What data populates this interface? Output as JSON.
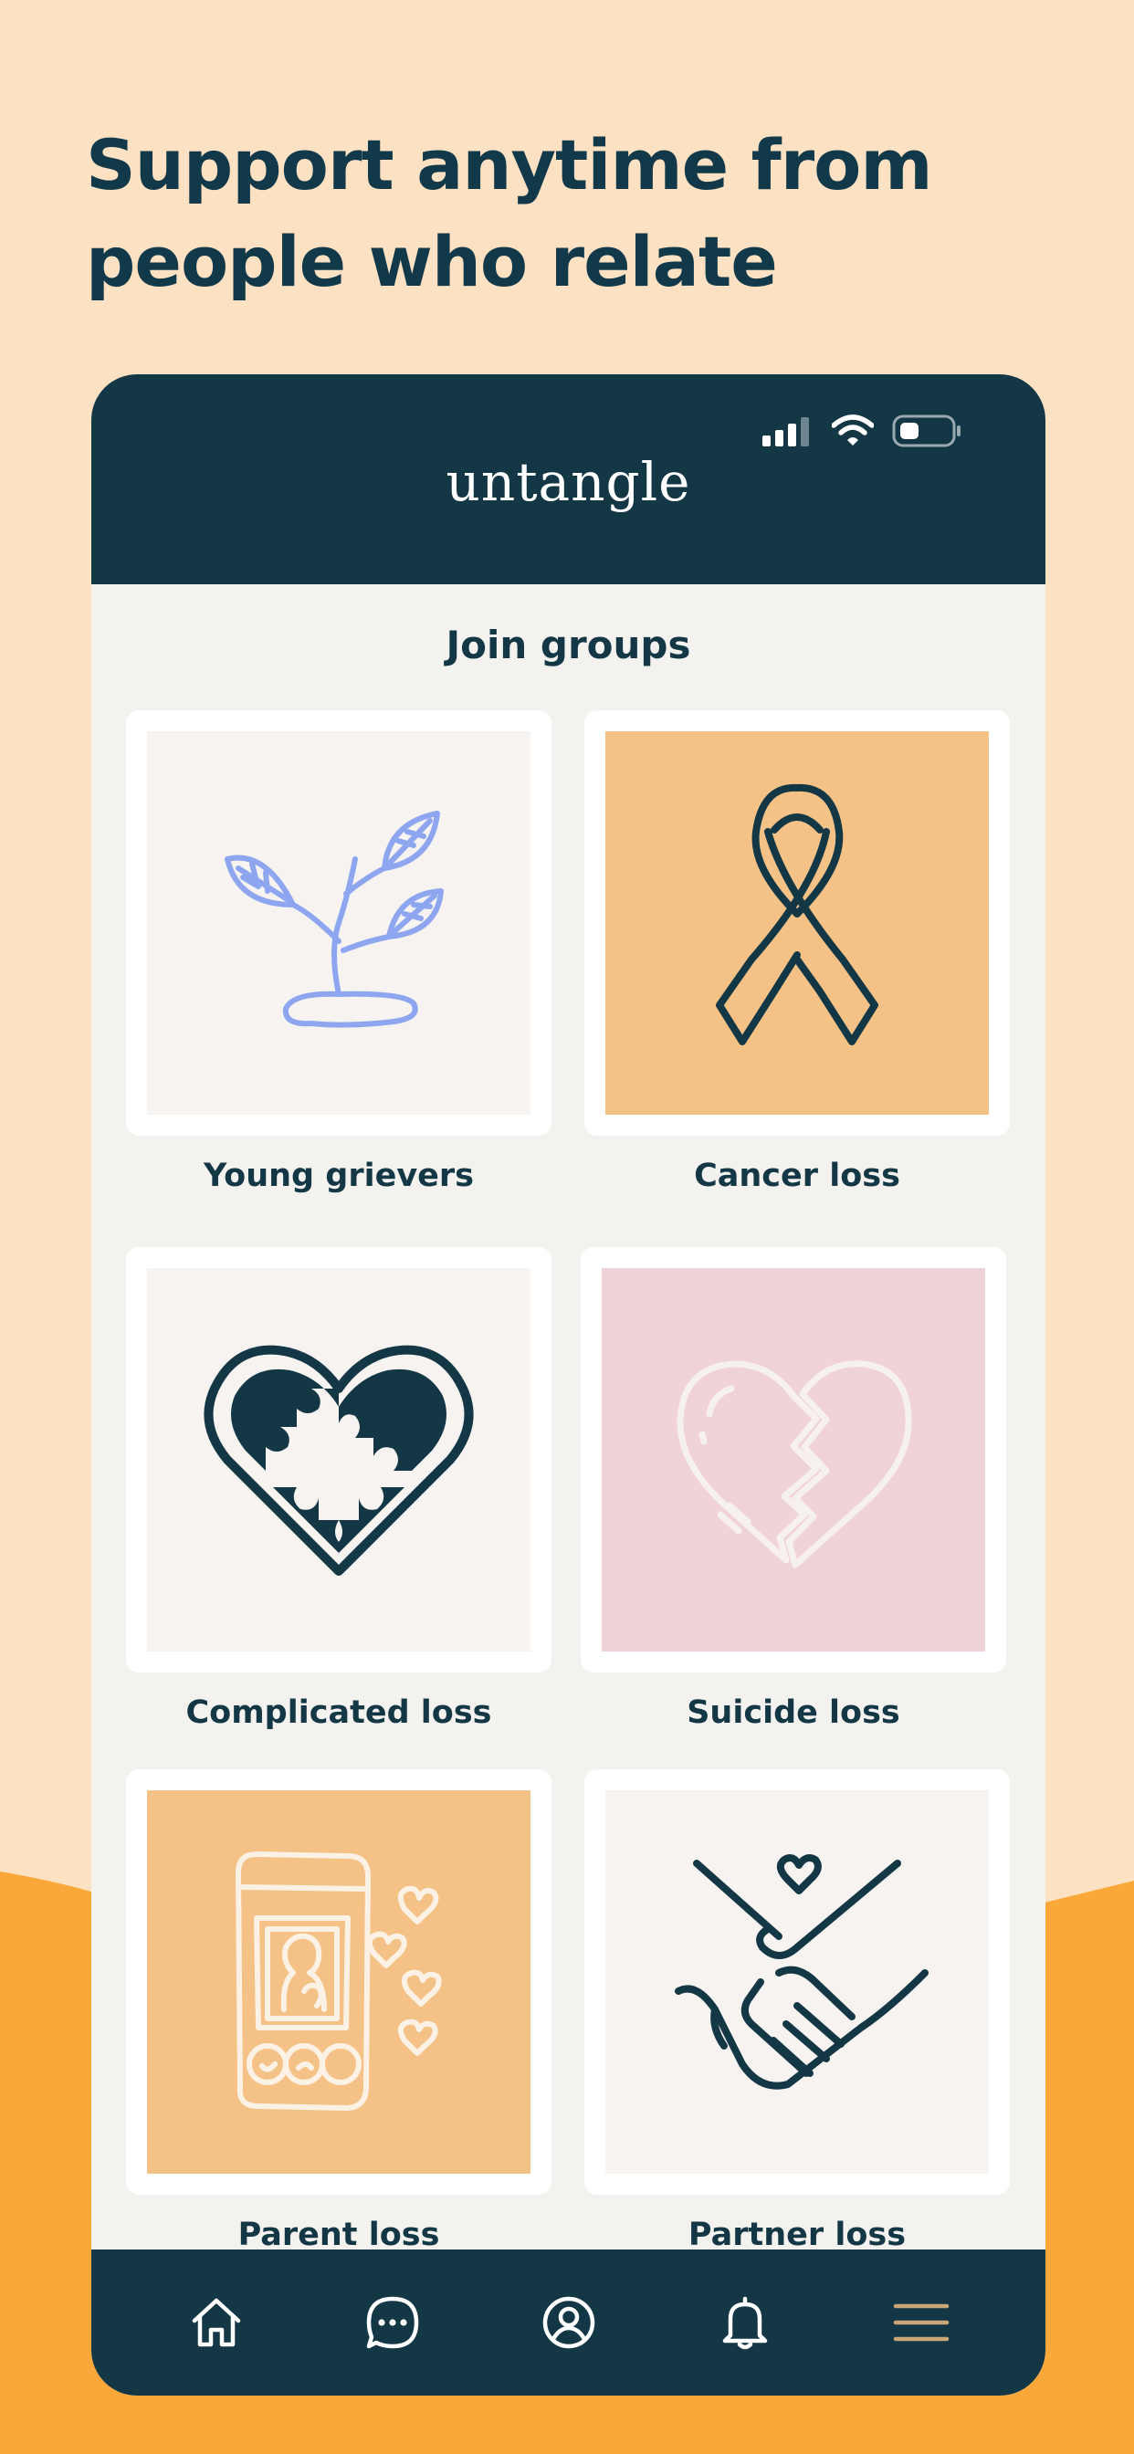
{
  "headline": {
    "line1": "Support anytime from",
    "line2": "people who relate"
  },
  "app": {
    "logo": "untangle",
    "section_title": "Join groups"
  },
  "status_bar": {
    "icons": [
      "signal-icon",
      "wifi-icon",
      "battery-icon"
    ]
  },
  "groups": [
    {
      "label": "Young grievers",
      "icon": "sprout-icon",
      "tile_color": "#f7f3f1"
    },
    {
      "label": "Cancer loss",
      "icon": "ribbon-icon",
      "tile_color": "#f4c287"
    },
    {
      "label": "Complicated loss",
      "icon": "puzzle-heart-icon",
      "tile_color": "#f7f3f1"
    },
    {
      "label": "Suicide loss",
      "icon": "broken-heart-icon",
      "tile_color": "#f0d3d8"
    },
    {
      "label": "Parent loss",
      "icon": "phone-photo-hearts-icon",
      "tile_color": "#f4c287"
    },
    {
      "label": "Partner loss",
      "icon": "holding-hands-icon",
      "tile_color": "#f7f3f1"
    }
  ],
  "tabbar": {
    "items": [
      "home-icon",
      "chat-icon",
      "profile-icon",
      "bell-icon",
      "menu-icon"
    ],
    "active_accent": "#c9a678"
  },
  "colors": {
    "peach_bg": "#fce1c3",
    "orange_bg": "#fba83a",
    "navy": "#143746",
    "light_panel": "#f3f2ef"
  }
}
